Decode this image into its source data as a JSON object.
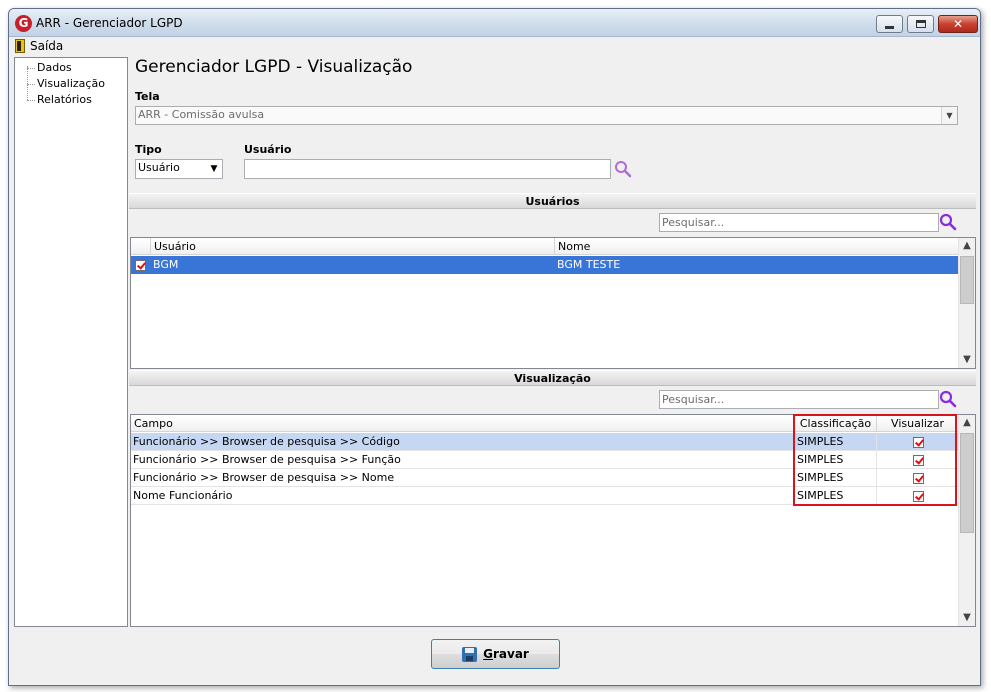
{
  "window": {
    "title": "ARR - Gerenciador LGPD",
    "logo_letter": "G",
    "close_glyph": "✕"
  },
  "menu": {
    "exit_label": "Saída",
    "exit_icon": "exit-door-icon"
  },
  "sidebar": {
    "items": [
      {
        "label": "Dados"
      },
      {
        "label": "Visualização"
      },
      {
        "label": "Relatórios"
      }
    ]
  },
  "page": {
    "title": "Gerenciador LGPD - Visualização"
  },
  "tela": {
    "label": "Tela",
    "value": "ARR - Comissão avulsa"
  },
  "tipo": {
    "label": "Tipo",
    "value": "Usuário"
  },
  "usuario": {
    "label": "Usuário",
    "value": ""
  },
  "usuarios_section": {
    "title": "Usuários",
    "search_placeholder": "Pesquisar...",
    "columns": [
      "Usuário",
      "Nome"
    ],
    "rows": [
      {
        "checked": true,
        "usuario": "BGM",
        "nome": "BGM TESTE",
        "selected": true
      }
    ]
  },
  "visualizacao_section": {
    "title": "Visualização",
    "search_placeholder": "Pesquisar...",
    "columns": [
      "Campo",
      "Classificação",
      "Visualizar"
    ],
    "rows": [
      {
        "campo": "Funcionário >> Browser de pesquisa >> Código",
        "classificacao": "SIMPLES",
        "visualizar": true
      },
      {
        "campo": "Funcionário >> Browser de pesquisa >> Função",
        "classificacao": "SIMPLES",
        "visualizar": true
      },
      {
        "campo": "Funcionário >> Browser de pesquisa >> Nome",
        "classificacao": "SIMPLES",
        "visualizar": true
      },
      {
        "campo": "Nome Funcionário",
        "classificacao": "SIMPLES",
        "visualizar": true
      }
    ]
  },
  "footer": {
    "save_label_first": "G",
    "save_label_rest": "ravar"
  },
  "colors": {
    "selection": "#3875d7",
    "row_highlight": "#c6d7f3",
    "annotation_box": "#d9141c",
    "search_icon": "#8a2be2"
  }
}
